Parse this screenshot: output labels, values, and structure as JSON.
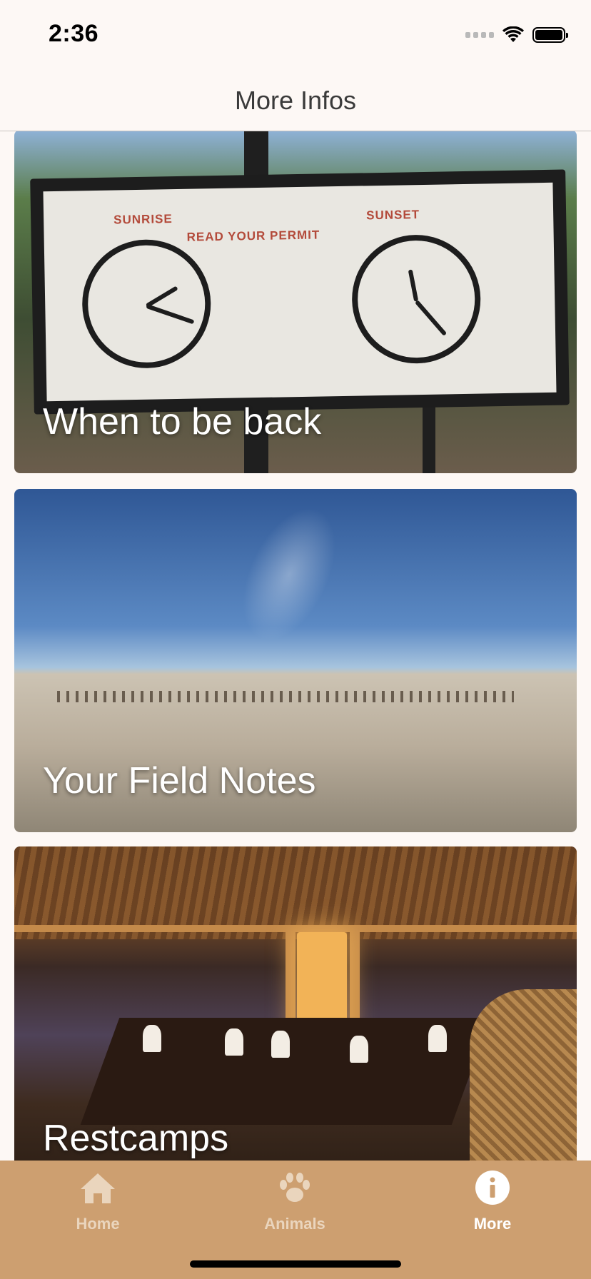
{
  "status_bar": {
    "time": "2:36"
  },
  "nav": {
    "title": "More Infos"
  },
  "cards": [
    {
      "label": "When to be back",
      "sign": {
        "sunrise": "SUNRISE",
        "sunset": "SUNSET",
        "permit": "READ YOUR PERMIT"
      }
    },
    {
      "label": "Your Field Notes"
    },
    {
      "label": "Restcamps"
    }
  ],
  "tab_bar": {
    "items": [
      {
        "label": "Home",
        "icon": "home-icon",
        "active": false
      },
      {
        "label": "Animals",
        "icon": "paw-icon",
        "active": false
      },
      {
        "label": "More",
        "icon": "info-icon",
        "active": true
      }
    ]
  },
  "colors": {
    "tab_bar_bg": "#cd9f70",
    "tab_inactive": "#ead5bd",
    "tab_active": "#ffffff",
    "background": "#fdf8f5"
  }
}
